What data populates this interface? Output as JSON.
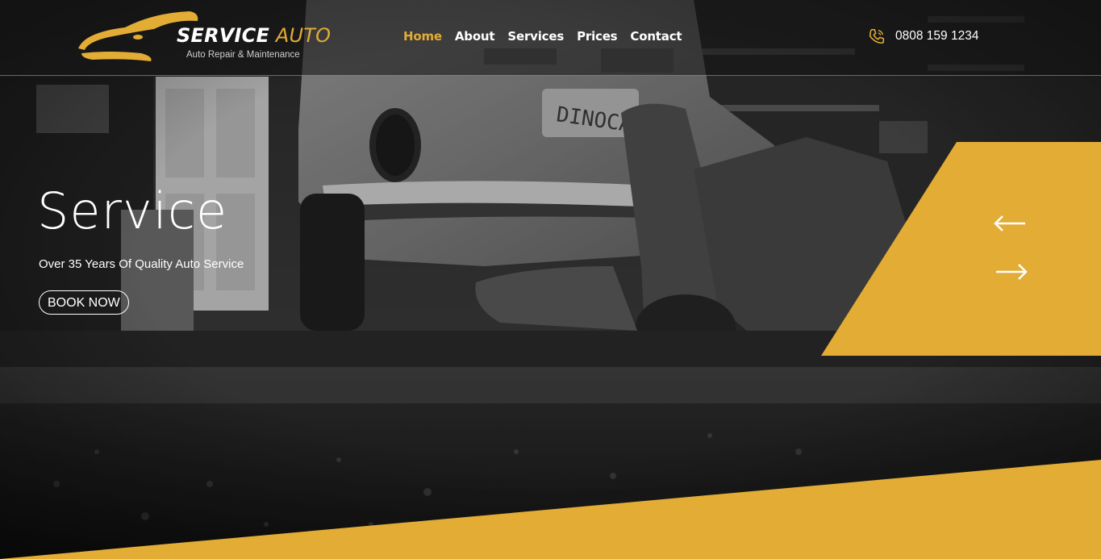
{
  "brand": {
    "name_part1": "SERVICE",
    "name_part2": "AUTO",
    "tagline": "Auto Repair & Maintenance",
    "accent_color": "#e2ac35"
  },
  "nav": {
    "items": [
      {
        "label": "Home",
        "active": true
      },
      {
        "label": "About",
        "active": false
      },
      {
        "label": "Services",
        "active": false
      },
      {
        "label": "Prices",
        "active": false
      },
      {
        "label": "Contact",
        "active": false
      }
    ]
  },
  "contact": {
    "phone_icon": "phone-icon",
    "phone_number": "0808 159 1234"
  },
  "slide": {
    "title": "Service",
    "subtitle": "Over 35 Years Of Quality Auto Service",
    "cta_label": "BOOK NOW",
    "background": "mechanic working under vintage car (grayscale photo)"
  },
  "slider_controls": {
    "prev_icon": "arrow-left-icon",
    "next_icon": "arrow-right-icon"
  },
  "colors": {
    "accent": "#e2ac35",
    "text": "#ffffff",
    "dark": "#1b1b1b"
  }
}
